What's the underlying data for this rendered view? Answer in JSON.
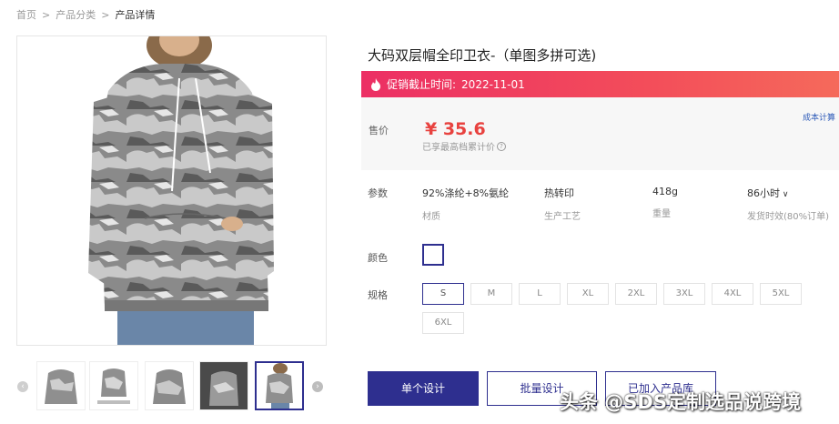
{
  "breadcrumb": {
    "home": "首页",
    "category": "产品分类",
    "current": "产品详情",
    "sep": ">"
  },
  "product": {
    "title": "大码双层帽全印卫衣-（单图多拼可选)"
  },
  "promo": {
    "label": "促销截止时间:",
    "date": "2022-11-01"
  },
  "pricing": {
    "label": "售价",
    "price": "¥ 35.6",
    "note": "已享最高档累计价",
    "cost_link": "成本计算"
  },
  "params": {
    "label": "参数",
    "items": [
      {
        "value": "92%涤纶+8%氨纶",
        "key": "材质"
      },
      {
        "value": "热转印",
        "key": "生产工艺"
      },
      {
        "value": "418g",
        "key": "重量"
      },
      {
        "value": "86小时",
        "key": "发货时效(80%订单)"
      }
    ]
  },
  "color": {
    "label": "颜色"
  },
  "sizes": {
    "label": "规格",
    "options": [
      "S",
      "M",
      "L",
      "XL",
      "2XL",
      "3XL",
      "4XL",
      "5XL",
      "6XL"
    ],
    "selected": "S"
  },
  "actions": {
    "single_design": "单个设计",
    "batch_design": "批量设计",
    "added_to_library": "已加入产品库"
  },
  "watermark": "头条 @SDS定制选品说跨境",
  "colors": {
    "brand": "#2e2f8f",
    "price": "#e8423f",
    "promo_start": "#ec2f64",
    "promo_end": "#f56a5b"
  }
}
